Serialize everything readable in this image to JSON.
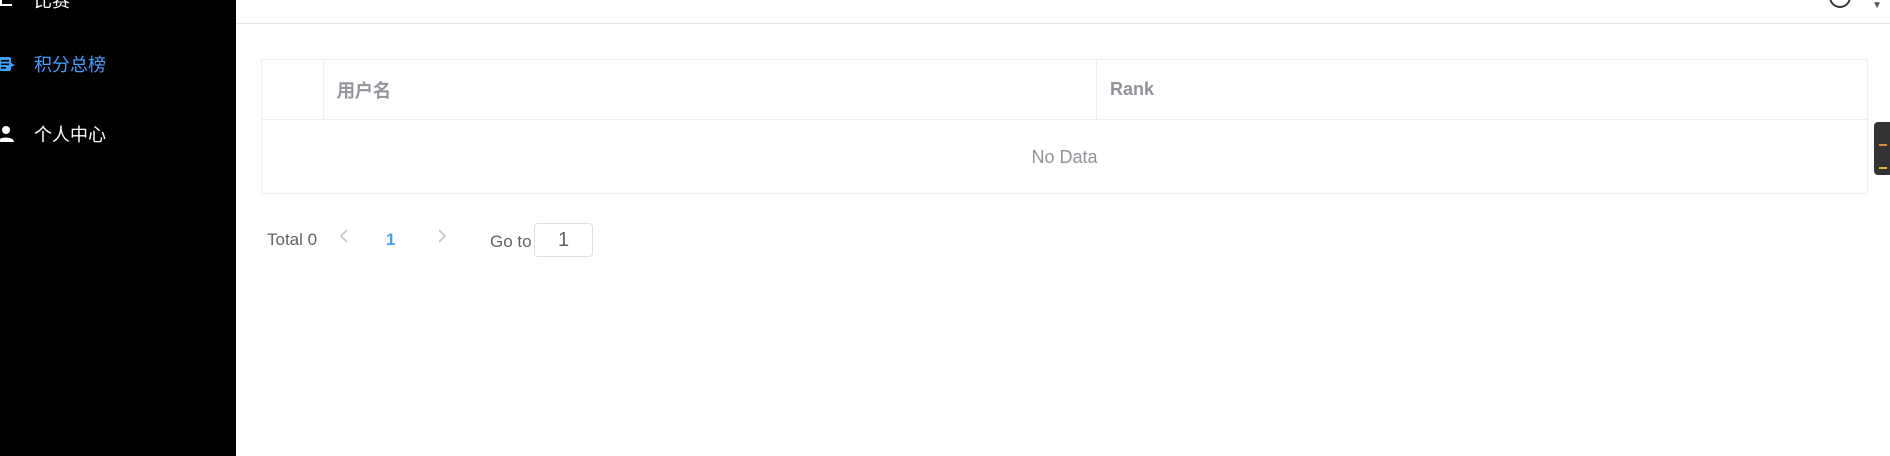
{
  "sidebar": {
    "items": [
      {
        "label": "比赛",
        "icon": "menu-icon",
        "active": false
      },
      {
        "label": "积分总榜",
        "icon": "ranking-list-icon",
        "active": true
      },
      {
        "label": "个人中心",
        "icon": "user-icon",
        "active": false
      }
    ]
  },
  "table": {
    "columns": [
      "",
      "用户名",
      "Rank"
    ],
    "empty_text": "No Data"
  },
  "pagination": {
    "total_label": "Total 0",
    "prev_icon": "chevron-left-icon",
    "current_page": "1",
    "next_icon": "chevron-right-icon",
    "goto_label": "Go to",
    "goto_value": "1"
  },
  "colors": {
    "sidebar_bg": "#000000",
    "accent": "#409eff",
    "header_text": "#909399"
  }
}
